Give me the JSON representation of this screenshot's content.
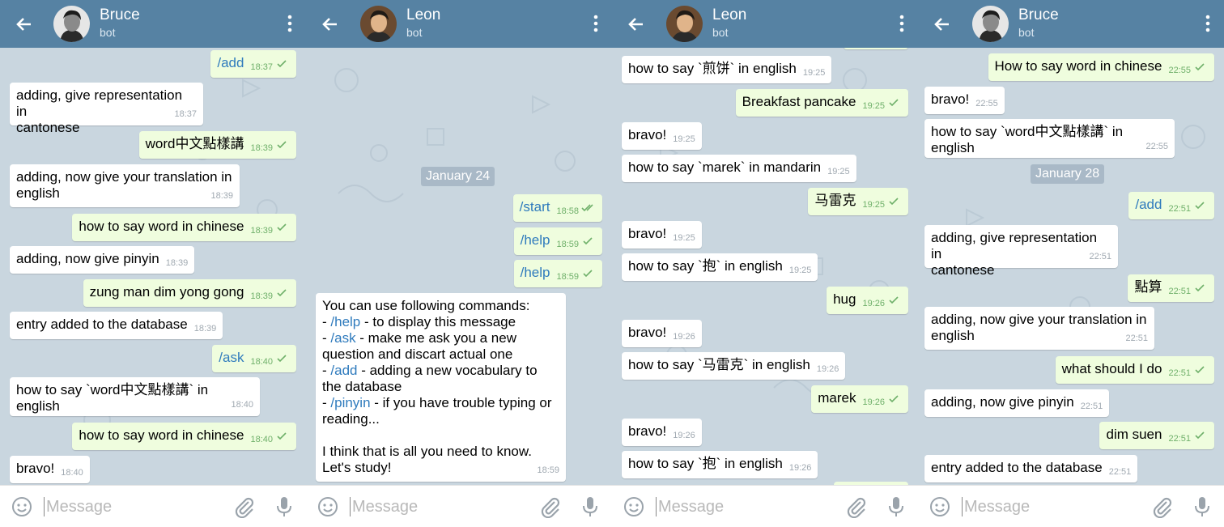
{
  "panels": [
    {
      "header": {
        "name": "Bruce",
        "subtitle": "bot"
      },
      "messages": [
        {
          "dir": "out",
          "text": "/add",
          "time": "18:37",
          "cmd": true
        },
        {
          "dir": "in",
          "text": "adding, give representation in\ncantonese",
          "time": "18:37"
        },
        {
          "dir": "out",
          "text": "word中文點樣講",
          "time": "18:39"
        },
        {
          "dir": "in",
          "text": "adding, now give your translation in\nenglish",
          "time": "18:39"
        },
        {
          "dir": "out",
          "text": "how to say word in chinese",
          "time": "18:39"
        },
        {
          "dir": "in",
          "text": "adding, now give pinyin",
          "time": "18:39"
        },
        {
          "dir": "out",
          "text": "zung man dim yong gong",
          "time": "18:39"
        },
        {
          "dir": "in",
          "text": "entry added to the database",
          "time": "18:39"
        },
        {
          "dir": "out",
          "text": "/ask",
          "time": "18:40",
          "cmd": true
        },
        {
          "dir": "in",
          "text": "how to say `word中文點樣講` in english",
          "time": "18:40"
        },
        {
          "dir": "out",
          "text": "how to say word in chinese",
          "time": "18:40"
        },
        {
          "dir": "in",
          "text": "bravo!",
          "time": "18:40"
        }
      ],
      "compose_placeholder": "Message"
    },
    {
      "header": {
        "name": "Leon",
        "subtitle": "bot"
      },
      "date": "January 24",
      "messages": [
        {
          "dir": "out",
          "text": "/start",
          "time": "18:58",
          "cmd": true
        },
        {
          "dir": "out",
          "text": "/help",
          "time": "18:59",
          "cmd": true
        },
        {
          "dir": "out",
          "text": "/help",
          "time": "18:59",
          "cmd": true
        }
      ],
      "help": {
        "intro": "You can use following commands:",
        "items": [
          {
            "cmd": "/help",
            "desc": " - to display this message"
          },
          {
            "cmd": "/ask",
            "desc": " - make me ask you a new question and discart actual one"
          },
          {
            "cmd": "/add",
            "desc": " - adding a new vocabulary to the database"
          },
          {
            "cmd": "/pinyin",
            "desc": " - if you have trouble typing or reading..."
          }
        ],
        "outro": "I think that is all you need to know.\nLet's study!",
        "time": "18:59"
      },
      "compose_placeholder": "Message"
    },
    {
      "header": {
        "name": "Leon",
        "subtitle": "bot"
      },
      "messages": [
        {
          "dir": "in",
          "text": "how to say `煎饼` in english",
          "time": "19:25"
        },
        {
          "dir": "out",
          "text": "Breakfast pancake",
          "time": "19:25"
        },
        {
          "dir": "in",
          "text": "bravo!",
          "time": "19:25"
        },
        {
          "dir": "in",
          "text": "how to say `marek` in mandarin",
          "time": "19:25"
        },
        {
          "dir": "out",
          "text": "马雷克",
          "time": "19:25"
        },
        {
          "dir": "in",
          "text": "bravo!",
          "time": "19:25"
        },
        {
          "dir": "in",
          "text": "how to say `抱` in english",
          "time": "19:25"
        },
        {
          "dir": "out",
          "text": "hug",
          "time": "19:26"
        },
        {
          "dir": "in",
          "text": "bravo!",
          "time": "19:26"
        },
        {
          "dir": "in",
          "text": "how to say `马雷克` in english",
          "time": "19:26"
        },
        {
          "dir": "out",
          "text": "marek",
          "time": "19:26"
        },
        {
          "dir": "in",
          "text": "bravo!",
          "time": "19:26"
        },
        {
          "dir": "in",
          "text": "how to say `抱` in english",
          "time": "19:26"
        }
      ],
      "compose_placeholder": "Message"
    },
    {
      "header": {
        "name": "Bruce",
        "subtitle": "bot"
      },
      "date": "January 28",
      "messages": [
        {
          "dir": "out",
          "text": "How to say word in chinese",
          "time": "22:55"
        },
        {
          "dir": "in",
          "text": "bravo!",
          "time": "22:55"
        },
        {
          "dir": "in",
          "text": "how to say `word中文點樣講` in english",
          "time": "22:55"
        },
        {
          "dir": "out",
          "text": "/add",
          "time": "22:51",
          "cmd": true
        },
        {
          "dir": "in",
          "text": "adding, give representation in\ncantonese",
          "time": "22:51"
        },
        {
          "dir": "out",
          "text": "點算",
          "time": "22:51"
        },
        {
          "dir": "in",
          "text": "adding, now give your translation in\nenglish",
          "time": "22:51"
        },
        {
          "dir": "out",
          "text": "what should I do",
          "time": "22:51"
        },
        {
          "dir": "in",
          "text": "adding, now give pinyin",
          "time": "22:51"
        },
        {
          "dir": "out",
          "text": "dim suen",
          "time": "22:51"
        },
        {
          "dir": "in",
          "text": "entry added to the database",
          "time": "22:51"
        }
      ],
      "compose_placeholder": "Message"
    }
  ]
}
